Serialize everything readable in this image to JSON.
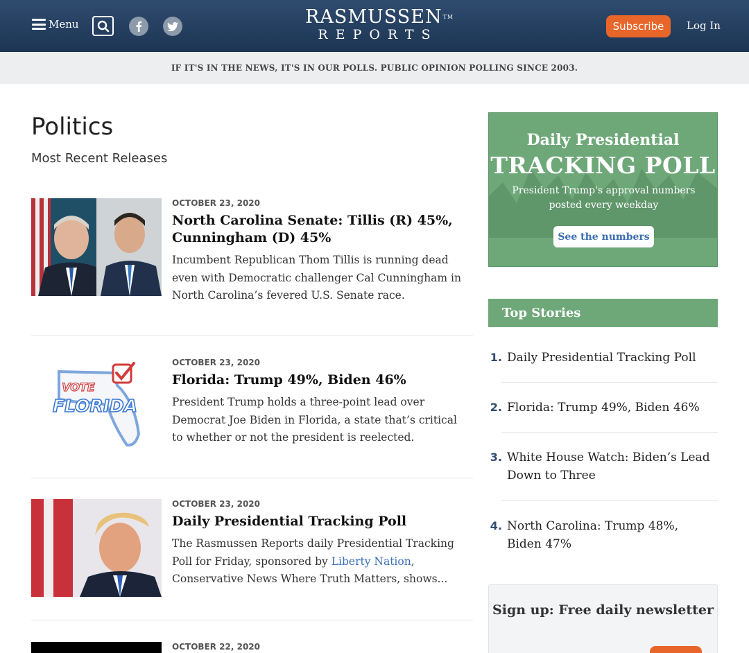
{
  "header": {
    "menu_label": "Menu",
    "logo_line1": "RASMUSSEN",
    "logo_tm": "TM",
    "logo_line2": "REPORTS",
    "subscribe_label": "Subscribe",
    "login_label": "Log In",
    "icons": [
      "menu-icon",
      "search-icon",
      "facebook-icon",
      "twitter-icon"
    ],
    "colors": {
      "header_bg": "#243d5e",
      "subscribe_bg": "#e8662a"
    }
  },
  "tagline": "IF IT'S IN THE NEWS, IT'S IN OUR POLLS. PUBLIC OPINION POLLING SINCE 2003.",
  "main": {
    "title": "Politics",
    "subtitle": "Most Recent Releases",
    "articles": [
      {
        "date": "OCTOBER 23, 2020",
        "headline": "North Carolina Senate: Tillis (R) 45%, Cunningham (D) 45%",
        "summary": "Incumbent Republican Thom Tillis is running dead even with Democratic challenger Cal Cunningham in North Carolina’s fevered U.S. Senate race."
      },
      {
        "date": "OCTOBER 23, 2020",
        "headline": "Florida: Trump 49%, Biden 46%",
        "summary": "President Trump holds a three-point lead over Democrat Joe Biden in Florida, a state that’s critical to whether or not the president is reelected.",
        "thumb_text_1": "VOTE",
        "thumb_text_2": "FLORIDA"
      },
      {
        "date": "OCTOBER 23, 2020",
        "headline": "Daily Presidential Tracking Poll",
        "summary_before": "The Rasmussen Reports daily Presidential Tracking Poll for Friday, sponsored by ",
        "summary_link": "Liberty Nation",
        "summary_after": ", Conservative News Where Truth Matters, shows..."
      },
      {
        "date": "OCTOBER 22, 2020"
      }
    ]
  },
  "sidebar": {
    "promo": {
      "line1": "Daily Presidential",
      "line2": "TRACKING POLL",
      "line3": "President Trump's approval numbers posted every weekday",
      "cta": "See the numbers",
      "color": "#6ea879"
    },
    "top_stories": {
      "heading": "Top Stories",
      "items": [
        {
          "num": "1.",
          "text": "Daily Presidential Tracking Poll"
        },
        {
          "num": "2.",
          "text": "Florida: Trump 49%, Biden 46%"
        },
        {
          "num": "3.",
          "text": "White House Watch: Biden’s Lead Down to Three"
        },
        {
          "num": "4.",
          "text": "North Carolina: Trump 48%, Biden 47%"
        }
      ]
    },
    "signup": {
      "title": "Sign up: Free daily newsletter"
    }
  }
}
